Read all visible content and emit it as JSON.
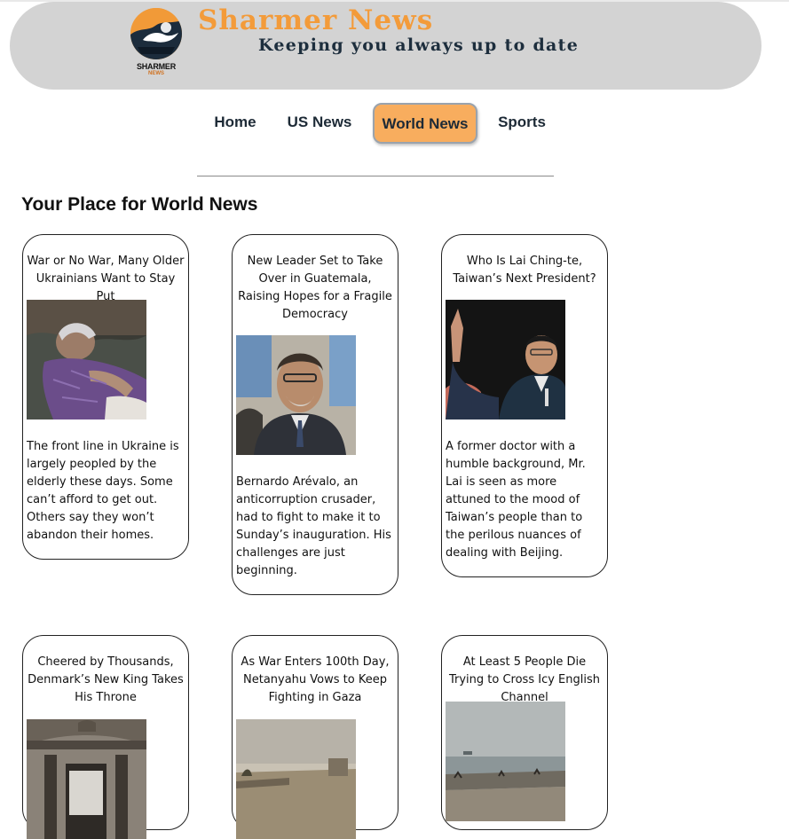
{
  "header": {
    "logo_text": "SHARMER",
    "logo_subtext": "NEWS",
    "title": "Sharmer News",
    "tagline": "Keeping you always up to date"
  },
  "nav": {
    "items": [
      {
        "label": "Home",
        "active": false
      },
      {
        "label": "US News",
        "active": false
      },
      {
        "label": "World News",
        "active": true
      },
      {
        "label": "Sports",
        "active": false
      }
    ],
    "active_color": "#f8ad5e"
  },
  "section": {
    "title": "Your Place for World News"
  },
  "articles": [
    {
      "title": "War or No War, Many Older Ukrainians Want to Stay Put",
      "image": "elderly-woman-in-bed-photo",
      "description": "The front line in Ukraine is largely peopled by the elderly these days. Some can’t afford to get out. Others say they won’t abandon their homes."
    },
    {
      "title": "New Leader Set to Take Over in Guatemala, Raising Hopes for a Fragile Democracy",
      "image": "bernardo-arevalo-photo",
      "description": "Bernardo Arévalo, an anticorruption crusader, had to fight to make it to Sunday’s inauguration. His challenges are just beginning."
    },
    {
      "title": "Who Is Lai Ching-te, Taiwan’s Next President?",
      "image": "lai-ching-te-waving-photo",
      "description": "A former doctor with a humble background, Mr. Lai is seen as more attuned to the mood of Taiwan’s people than to the perilous nuances of dealing with Beijing."
    },
    {
      "title": "Cheered by Thousands, Denmark’s New King Takes His Throne",
      "image": "palace-balcony-photo",
      "description": ""
    },
    {
      "title": "As War Enters 100th Day, Netanyahu Vows to Keep Fighting in Gaza",
      "image": "gaza-skyline-photo",
      "description": ""
    },
    {
      "title": "At Least 5 People Die Trying to Cross Icy English Channel",
      "image": "english-channel-beach-photo",
      "description": ""
    }
  ]
}
